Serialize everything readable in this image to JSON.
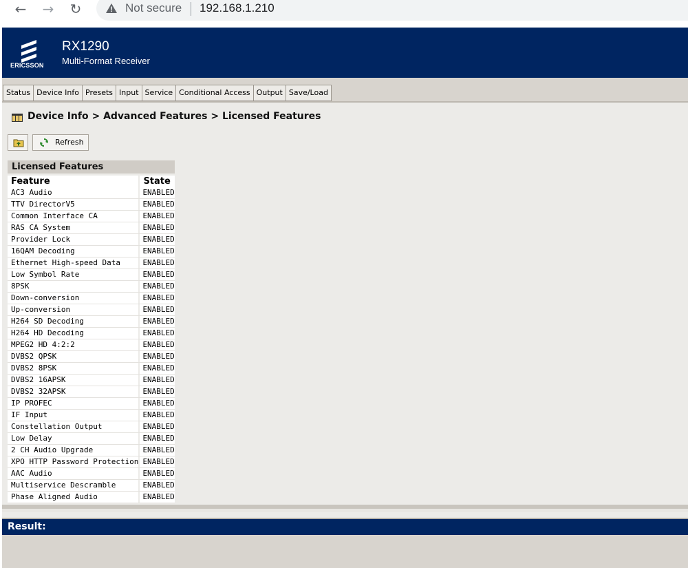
{
  "browser": {
    "security_label": "Not secure",
    "url": "192.168.1.210"
  },
  "header": {
    "brand": "ERICSSON",
    "product": "RX1290",
    "subtitle": "Multi-Format Receiver"
  },
  "tabs": [
    "Status",
    "Device Info",
    "Presets",
    "Input",
    "Service",
    "Conditional Access",
    "Output",
    "Save/Load"
  ],
  "breadcrumb": {
    "text": "Device Info > Advanced Features > Licensed Features"
  },
  "toolbar": {
    "refresh_label": "Refresh"
  },
  "panel": {
    "title": "Licensed Features",
    "columns": [
      "Feature",
      "State"
    ],
    "rows": [
      [
        "AC3 Audio",
        "ENABLED"
      ],
      [
        "TTV DirectorV5",
        "ENABLED"
      ],
      [
        "Common Interface CA",
        "ENABLED"
      ],
      [
        "RAS CA System",
        "ENABLED"
      ],
      [
        "Provider Lock",
        "ENABLED"
      ],
      [
        "16QAM Decoding",
        "ENABLED"
      ],
      [
        "Ethernet High-speed Data",
        "ENABLED"
      ],
      [
        "Low Symbol Rate",
        "ENABLED"
      ],
      [
        "8PSK",
        "ENABLED"
      ],
      [
        "Down-conversion",
        "ENABLED"
      ],
      [
        "Up-conversion",
        "ENABLED"
      ],
      [
        "H264 SD Decoding",
        "ENABLED"
      ],
      [
        "H264 HD Decoding",
        "ENABLED"
      ],
      [
        "MPEG2 HD 4:2:2",
        "ENABLED"
      ],
      [
        "DVBS2 QPSK",
        "ENABLED"
      ],
      [
        "DVBS2 8PSK",
        "ENABLED"
      ],
      [
        "DVBS2 16APSK",
        "ENABLED"
      ],
      [
        "DVBS2 32APSK",
        "ENABLED"
      ],
      [
        "IP PROFEC",
        "ENABLED"
      ],
      [
        "IF Input",
        "ENABLED"
      ],
      [
        "Constellation Output",
        "ENABLED"
      ],
      [
        "Low Delay",
        "ENABLED"
      ],
      [
        "2 CH Audio Upgrade",
        "ENABLED"
      ],
      [
        "XPO HTTP Password Protection",
        "ENABLED"
      ],
      [
        "AAC Audio",
        "ENABLED"
      ],
      [
        "Multiservice Descramble",
        "ENABLED"
      ],
      [
        "Phase Aligned Audio",
        "ENABLED"
      ]
    ]
  },
  "result": {
    "label": "Result:"
  },
  "icons": {
    "back": "back-arrow-icon",
    "forward": "forward-arrow-icon",
    "reload": "reload-icon",
    "warning": "warning-triangle-icon",
    "breadcrumb": "panel-icon",
    "up": "folder-up-icon",
    "refresh": "refresh-icon"
  },
  "colors": {
    "header_bg": "#002561",
    "tabbar_bg": "#d8d4ce",
    "page_bg": "#ecebe8"
  }
}
